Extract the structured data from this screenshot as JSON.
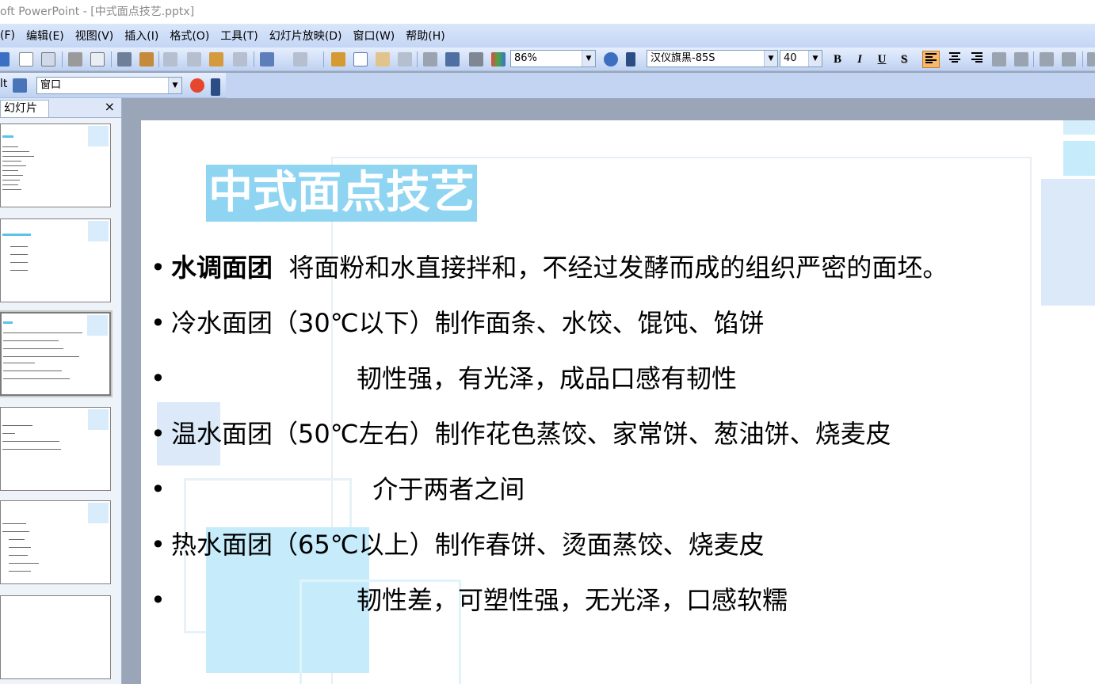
{
  "window": {
    "title": "oft PowerPoint - [中式面点技艺.pptx]"
  },
  "menu": [
    "(F)",
    "编辑(E)",
    "视图(V)",
    "插入(I)",
    "格式(O)",
    "工具(T)",
    "幻灯片放映(D)",
    "窗口(W)",
    "帮助(H)"
  ],
  "toolbar": {
    "zoom": "86%",
    "font_name": "汉仪旗黑-85S",
    "font_size": "40",
    "bold": "B",
    "italic": "I",
    "underline": "U",
    "shadow": "S"
  },
  "toolbar2": {
    "label_left": "lt",
    "window_combo": "窗口"
  },
  "pane": {
    "tab_label": "幻灯片",
    "close": "×"
  },
  "slide": {
    "title": "中式面点技艺",
    "bullets": [
      {
        "bold": "水调面团",
        "text": "  将面粉和水直接拌和，不经过发酵而成的组织严密的面坯。"
      },
      {
        "bold": "",
        "text": "冷水面团（30℃以下）制作面条、水饺、馄饨、馅饼"
      },
      {
        "bold": "",
        "text": "                       韧性强，有光泽，成品口感有韧性"
      },
      {
        "bold": "",
        "text": "温水面团（50℃左右）制作花色蒸饺、家常饼、葱油饼、烧麦皮"
      },
      {
        "bold": "",
        "text": "                         介于两者之间"
      },
      {
        "bold": "",
        "text": "热水面团（65℃以上）制作春饼、烫面蒸饺、烧麦皮"
      },
      {
        "bold": "",
        "text": "                       韧性差，可塑性强，无光泽，口感软糯"
      }
    ],
    "bullet_char": "•"
  },
  "colors": {
    "title_bg": "#8fd5f2",
    "accent_light": "#c6ebfb",
    "toolbar_blue": "#c4d6f5"
  }
}
